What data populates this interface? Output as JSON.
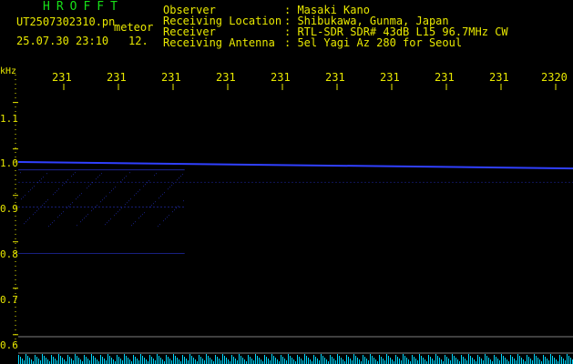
{
  "header": {
    "app_title": "HROFFT",
    "file_name": "UT2507302310.pn",
    "mode": "meteor",
    "date": "25.07.30 23:10",
    "counter": "12."
  },
  "info": [
    {
      "key": "Observer",
      "value": ": Masaki Kano"
    },
    {
      "key": "Receiving Location",
      "value": ": Shibukawa, Gunma, Japan"
    },
    {
      "key": "Receiver",
      "value": ": RTL-SDR SDR# 43dB L15 96.7MHz CW"
    },
    {
      "key": "Receiving Antenna",
      "value": ": 5el Yagi Az 280 for Seoul"
    }
  ],
  "colors": {
    "background": "#000000",
    "text": "#e8e800",
    "title": "#18e018",
    "signal": "#3040ff",
    "noise": "#00d8ff",
    "grid": "#808080"
  },
  "chart_data": {
    "type": "heatmap",
    "ylabel": "kHz",
    "x_ticks": [
      "231",
      "231",
      "231",
      "231",
      "231",
      "231",
      "231",
      "231",
      "231",
      "2320"
    ],
    "y_ticks": [
      "1.1",
      "1.0",
      "0.9",
      "0.8",
      "0.7",
      "0.6"
    ],
    "ylim": [
      0.58,
      1.16
    ],
    "traces": [
      {
        "freq_start": 0.972,
        "freq_end": 0.958,
        "intensity": 1.0
      },
      {
        "freq_start": 0.955,
        "freq_end": 0.955,
        "intensity": 0.6,
        "x_end_fraction": 0.3
      },
      {
        "freq_start": 0.928,
        "freq_end": 0.928,
        "intensity": 0.35
      },
      {
        "freq_start": 0.875,
        "freq_end": 0.875,
        "intensity": 0.45,
        "x_end_fraction": 0.3
      },
      {
        "freq_start": 0.775,
        "freq_end": 0.775,
        "intensity": 0.5,
        "x_end_fraction": 0.3
      }
    ]
  }
}
